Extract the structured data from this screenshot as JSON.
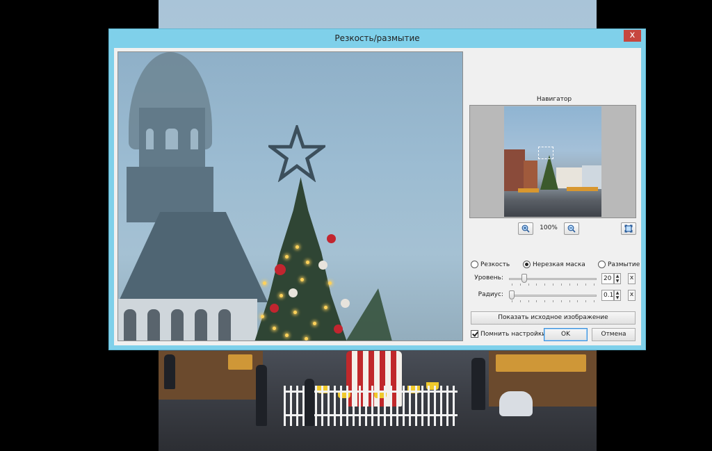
{
  "dialog": {
    "title": "Резкость/размытие",
    "close_label": "x"
  },
  "navigator": {
    "label": "Навигатор",
    "zoom_level": "100%"
  },
  "modes": [
    {
      "label": "Резкость",
      "selected": false
    },
    {
      "label": "Нерезкая маска",
      "selected": true
    },
    {
      "label": "Размытие",
      "selected": false
    }
  ],
  "params": {
    "level": {
      "label": "Уровень:",
      "value": "20",
      "reset": "x",
      "position": 0.15
    },
    "radius": {
      "label": "Радиус:",
      "value": "0.1",
      "reset": "x",
      "position": 0.0
    }
  },
  "buttons": {
    "show_original": "Показать исходное изображение",
    "ok": "OK",
    "cancel": "Отмена"
  },
  "remember": {
    "label": "Помнить настройки",
    "checked": true
  },
  "icons": {
    "zoom_in": "zoom-in-icon",
    "zoom_out": "zoom-out-icon",
    "fit": "fit-to-window-icon"
  },
  "colors": {
    "frame": "#7fd0ea",
    "close": "#c7463f",
    "client": "#f0f0f0"
  }
}
